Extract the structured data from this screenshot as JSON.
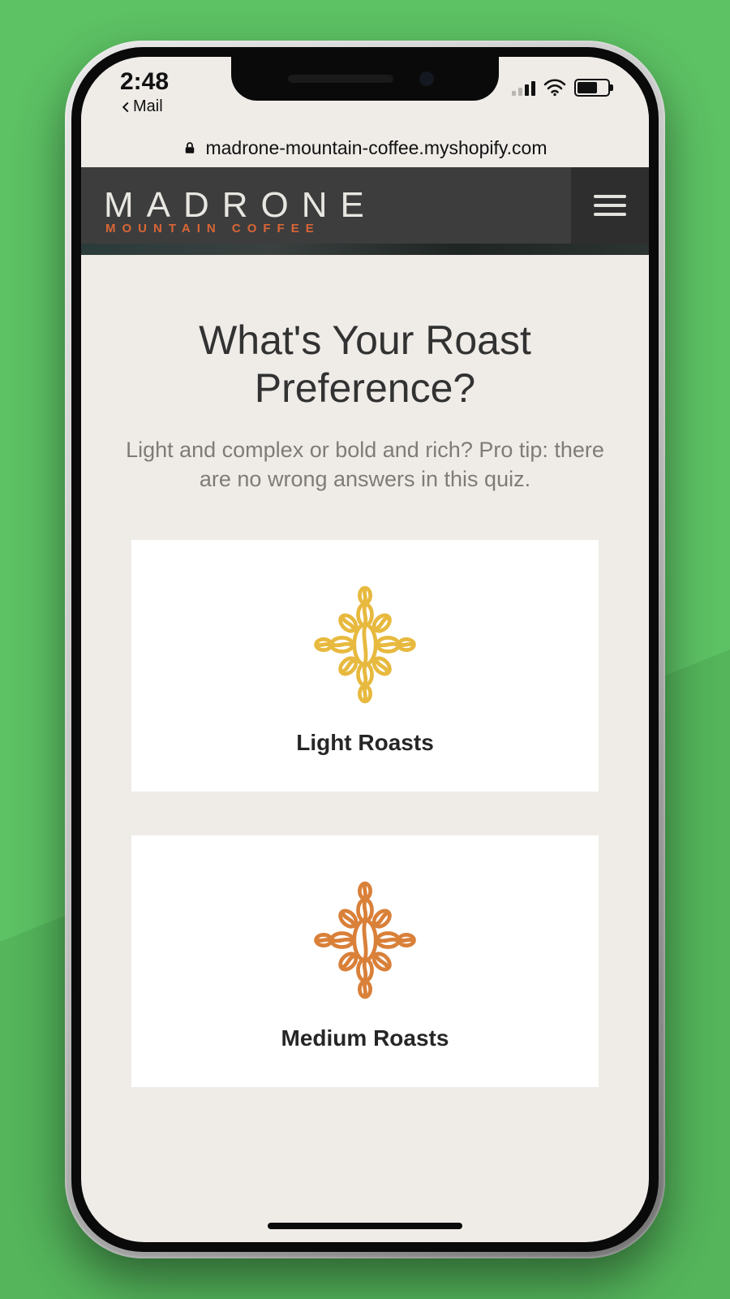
{
  "status": {
    "time": "2:48",
    "back_app": "Mail"
  },
  "browser": {
    "host": "madrone-mountain-coffee.myshopify.com"
  },
  "brand": {
    "name": "MADRONE",
    "subline": "MOUNTAIN COFFEE"
  },
  "quiz": {
    "title": "What's Your Roast Preference?",
    "subtitle": "Light and complex or bold and rich? Pro tip: there are no wrong answers in this quiz.",
    "options": [
      {
        "label": "Light Roasts",
        "icon_color": "#e7b93e"
      },
      {
        "label": "Medium Roasts",
        "icon_color": "#d98039"
      }
    ]
  }
}
